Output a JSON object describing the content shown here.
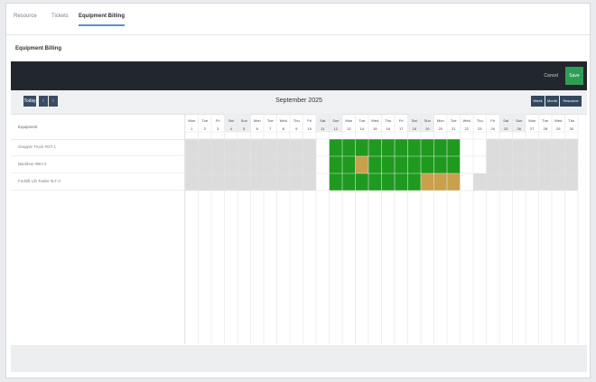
{
  "tabs": [
    {
      "label": "Resource",
      "active": false
    },
    {
      "label": "Tickets",
      "active": false
    },
    {
      "label": "Equipment Billing",
      "active": true
    }
  ],
  "section_title": "Equipment Billing",
  "toolbar": {
    "cancel_label": "Cancel",
    "save_label": "Save"
  },
  "calendar": {
    "today_label": "Today",
    "prev_label": "‹",
    "next_label": "›",
    "month_title": "September 2025",
    "views": [
      "Week",
      "Month",
      "Resource"
    ],
    "resource_header": "Equipment",
    "day_names": [
      "Mon",
      "Tue",
      "Fri",
      "Sat",
      "Sun",
      "Mon",
      "Tue",
      "Wed",
      "Thu",
      "Fri",
      "Sat",
      "Sun",
      "Mon",
      "Tue",
      "Wed",
      "Thu",
      "Fri",
      "Sat",
      "Sun",
      "Mon",
      "Tue",
      "Wed",
      "Thu",
      "Fri",
      "Sat",
      "Sun",
      "Mon",
      "Tue",
      "Wed",
      "Thu"
    ],
    "day_numbers": [
      1,
      2,
      3,
      4,
      5,
      6,
      7,
      8,
      9,
      10,
      11,
      12,
      13,
      14,
      15,
      16,
      17,
      18,
      19,
      20,
      21,
      22,
      23,
      24,
      25,
      26,
      27,
      28,
      29,
      30
    ],
    "weekend_columns": [
      3,
      4,
      10,
      11,
      17,
      18,
      24,
      25
    ],
    "resources": [
      {
        "name": "Grapple Truck #GT-1"
      },
      {
        "name": "Backhoe #BH-2"
      },
      {
        "name": "Forklift Lift Trailer #LT-3"
      }
    ],
    "colors": {
      "booked": "#1f9a1f",
      "partial": "#c9a04b",
      "unavailable": "#dcdcdc"
    },
    "cells": [
      {
        "row": 0,
        "from": 0,
        "to": 9,
        "state": "unavailable"
      },
      {
        "row": 0,
        "from": 11,
        "to": 20,
        "state": "booked"
      },
      {
        "row": 1,
        "from": 0,
        "to": 9,
        "state": "unavailable"
      },
      {
        "row": 1,
        "from": 11,
        "to": 20,
        "state": "booked"
      },
      {
        "row": 1,
        "from": 13,
        "to": 13,
        "state": "partial"
      },
      {
        "row": 2,
        "from": 0,
        "to": 9,
        "state": "unavailable"
      },
      {
        "row": 2,
        "from": 11,
        "to": 17,
        "state": "booked"
      },
      {
        "row": 2,
        "from": 18,
        "to": 20,
        "state": "partial"
      },
      {
        "row": 0,
        "from": 23,
        "to": 29,
        "state": "unavailable"
      },
      {
        "row": 1,
        "from": 23,
        "to": 29,
        "state": "unavailable"
      },
      {
        "row": 2,
        "from": 22,
        "to": 29,
        "state": "unavailable"
      }
    ]
  }
}
